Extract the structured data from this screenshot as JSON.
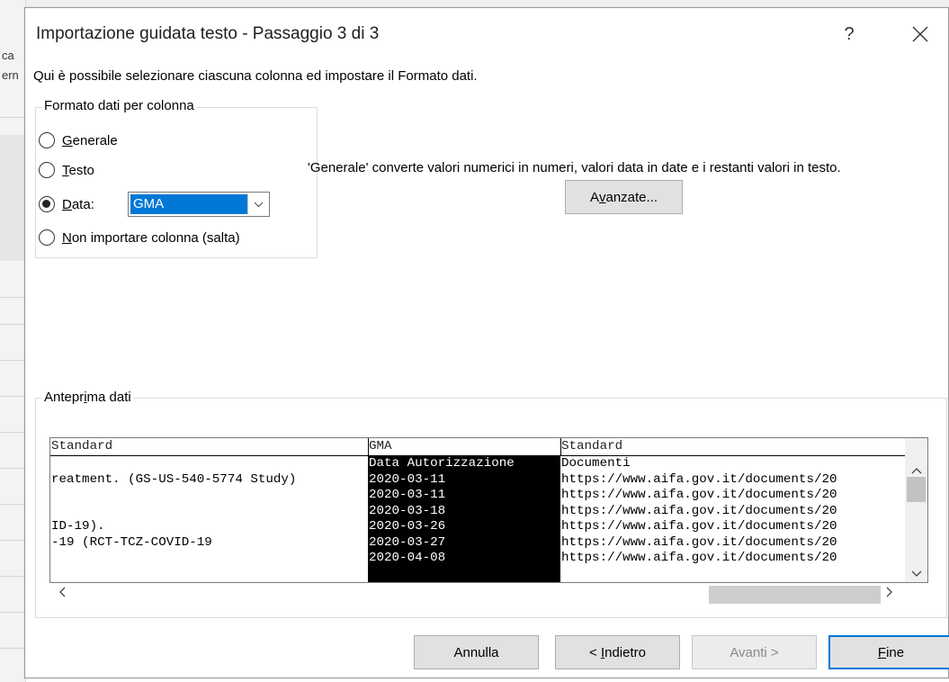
{
  "background": {
    "text1": "ca",
    "text2": "ern"
  },
  "dialog": {
    "title": "Importazione guidata testo - Passaggio 3 di 3",
    "help_label": "?",
    "close_label": "✕",
    "instruction": "Qui è possibile selezionare ciascuna colonna ed impostare il Formato dati."
  },
  "format_group": {
    "label": "Formato dati per colonna",
    "options": [
      {
        "mnemonic": "G",
        "rest": "enerale",
        "checked": false
      },
      {
        "mnemonic": "T",
        "rest": "esto",
        "checked": false
      },
      {
        "mnemonic": "D",
        "rest": "ata:",
        "checked": true
      },
      {
        "mnemonic": "N",
        "rest": "on importare colonna (salta)",
        "checked": false
      }
    ],
    "date_format": "GMA"
  },
  "description": "'Generale' converte valori numerici in numeri, valori data in date e i restanti valori in testo.",
  "advanced_button": {
    "pre": "A",
    "mnemonic": "v",
    "post": "anzate..."
  },
  "preview": {
    "label_pre": "Antepr",
    "label_mnemonic": "i",
    "label_post": "ma dati",
    "columns": [
      {
        "header": "Standard",
        "cells": [
          "",
          "reatment. (GS-US-540-5774 Study)",
          "",
          "",
          "ID-19).",
          "-19 (RCT-TCZ-COVID-19",
          ""
        ]
      },
      {
        "header": "GMA",
        "cells": [
          "Data Autorizzazione",
          "2020-03-11",
          "2020-03-11",
          "2020-03-18",
          "2020-03-26",
          "2020-03-27",
          "2020-04-08"
        ]
      },
      {
        "header": "Standard",
        "cells": [
          "Documenti",
          "https://www.aifa.gov.it/documents/20",
          "https://www.aifa.gov.it/documents/20",
          "https://www.aifa.gov.it/documents/20",
          "https://www.aifa.gov.it/documents/20",
          "https://www.aifa.gov.it/documents/20",
          "https://www.aifa.gov.it/documents/20"
        ]
      }
    ]
  },
  "buttons": {
    "cancel": "Annulla",
    "back_pre": "< ",
    "back_mnemonic": "I",
    "back_post": "ndietro",
    "next": "Avanti >",
    "finish_mnemonic": "F",
    "finish_post": "ine"
  }
}
